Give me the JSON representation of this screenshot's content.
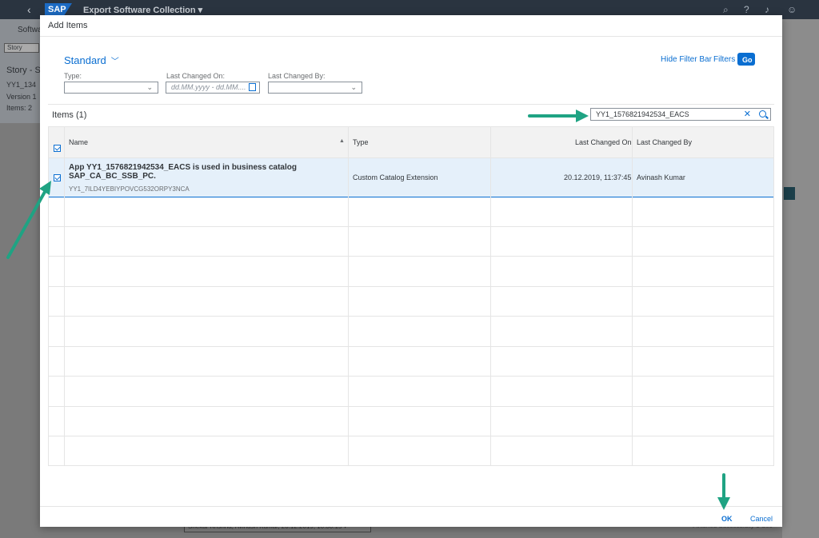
{
  "shell": {
    "app_title": "Export Software Collection ▾",
    "logo": "SAP"
  },
  "background": {
    "tab_label": "Softwa",
    "story_button": "Story",
    "title": "Story - S",
    "id": "YY1_134",
    "version": "Version 1",
    "items": "Items: 2",
    "bottom_text": "Shekar Krishna, Avinash Kumar, 20.12.2019, 10:30:15 ▾",
    "bottom_right": "Finished Successfully 1 Sec"
  },
  "dialog": {
    "title": "Add Items",
    "variant": "Standard",
    "hide_filter_bar": "Hide Filter Bar",
    "filters": "Filters",
    "go": "Go",
    "filters_fields": {
      "type_label": "Type:",
      "last_changed_on_label": "Last Changed On:",
      "last_changed_on_placeholder": "dd.MM.yyyy - dd.MM....",
      "last_changed_by_label": "Last Changed By:"
    },
    "items_title": "Items (1)",
    "search_value": "YY1_1576821942534_EACS",
    "columns": {
      "name": "Name",
      "type": "Type",
      "last_changed_on": "Last Changed On",
      "last_changed_by": "Last Changed By"
    },
    "rows": [
      {
        "name": "App YY1_1576821942534_EACS is used in business catalog SAP_CA_BC_SSB_PC.",
        "sub": "YY1_7ILD4YEBIYPOVCG532ORPY3NCA",
        "type": "Custom Catalog Extension",
        "last_changed_on": "20.12.2019, 11:37:45",
        "last_changed_by": "Avinash Kumar"
      }
    ],
    "ok": "OK",
    "cancel": "Cancel"
  },
  "colors": {
    "accent": "#0a6ed1",
    "annotation": "#1fa383",
    "selected_row": "#e5f0fa"
  }
}
